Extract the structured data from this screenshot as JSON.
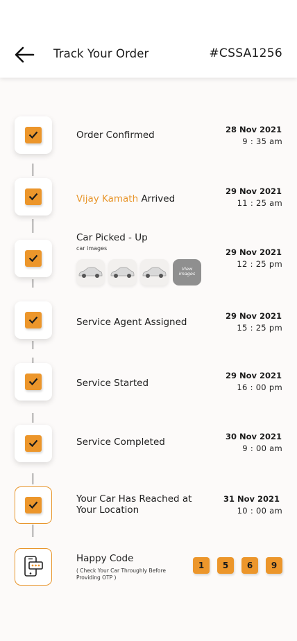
{
  "header": {
    "title": "Track Your Order",
    "order_id": "#CSSA1256"
  },
  "steps": [
    {
      "label": "Order Confirmed",
      "date": "28 Nov 2021",
      "time": "9 : 35 am"
    },
    {
      "label_highlight": "Vijay Kamath",
      "label": " Arrived",
      "date": "29 Nov 2021",
      "time": "11 : 25 am"
    },
    {
      "label": "Car Picked - Up",
      "sub": "car  images",
      "view_label": "View images",
      "date": "29 Nov 2021",
      "time": "12 : 25 pm"
    },
    {
      "label": "Service Agent Assigned",
      "date": "29 Nov 2021",
      "time": "15 : 25 pm"
    },
    {
      "label": "Service Started",
      "date": "29 Nov 2021",
      "time": "16 : 00 pm"
    },
    {
      "label": "Service Completed",
      "date": "30 Nov 2021",
      "time": "9 : 00 am"
    },
    {
      "label_line1": "Your Car Has Reached at",
      "label_line2": "Your Location",
      "date": "31 Nov 2021",
      "time": "10 : 00 am"
    }
  ],
  "happy_code": {
    "title": "Happy Code",
    "note": "( Check Your Car Throughly Before Providing OTP )",
    "digits": [
      "1",
      "5",
      "6",
      "9"
    ]
  },
  "colors": {
    "accent": "#ec962b",
    "background": "#fcfaf9"
  }
}
